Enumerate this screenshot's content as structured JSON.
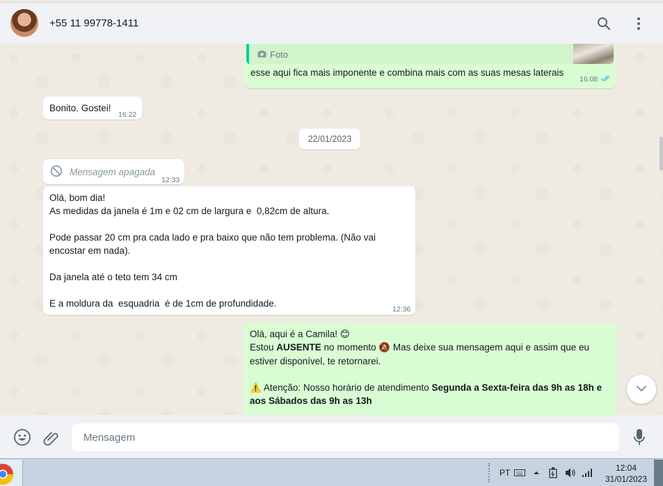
{
  "header": {
    "contact_name": "+55 11 99778-1411",
    "search_icon": "search-icon",
    "menu_icon": "more-vertical-icon"
  },
  "messages": {
    "photo": {
      "quote_label": "Foto",
      "text": "esse  aqui fica mais imponente e combina mais com as suas mesas laterais",
      "time": "16:08",
      "status": "read"
    },
    "bonito": {
      "text": "Bonito. Gostei!",
      "time": "16:22"
    },
    "date_chip": "22/01/2023",
    "deleted": {
      "text": "Mensagem apagada",
      "time": "12:33"
    },
    "medidas": {
      "text": "Olá, bom dia!\nAs medidas da janela é 1m e 02 cm de largura e  0,82cm de altura.\n\nPode passar 20 cm pra cada lado e pra baixo que não tem problema. (Não vai encostar em nada).\n\nDa janela até o teto tem 34 cm\n\nE a moldura da  esquadria  é de 1cm de profundidade.",
      "time": "12:36"
    },
    "auto_reply": {
      "line1": "Olá, aqui é a Camila! 😊",
      "line2_pre": "Estou ",
      "line2_bold": "AUSENTE",
      "line2_post": " no momento 🔕 Mas deixe sua mensagem aqui e assim que eu estiver disponível, te retornarei.",
      "line3_pre": "⚠️ Atenção: Nosso horário de atendimento ",
      "line3_bold": "Segunda a Sexta-feira das 9h as 18h e aos Sábados das 9h as 13h"
    }
  },
  "composer": {
    "placeholder": "Mensagem",
    "emoji_icon": "emoji-icon",
    "attach_icon": "paperclip-icon",
    "mic_icon": "microphone-icon"
  },
  "taskbar": {
    "language": "PT",
    "time": "12:04",
    "date": "31/01/2023"
  },
  "colors": {
    "outgoing_bubble": "#d9fdd3",
    "incoming_bubble": "#ffffff",
    "read_ticks": "#53bdeb",
    "chat_bg": "#efeae2"
  }
}
